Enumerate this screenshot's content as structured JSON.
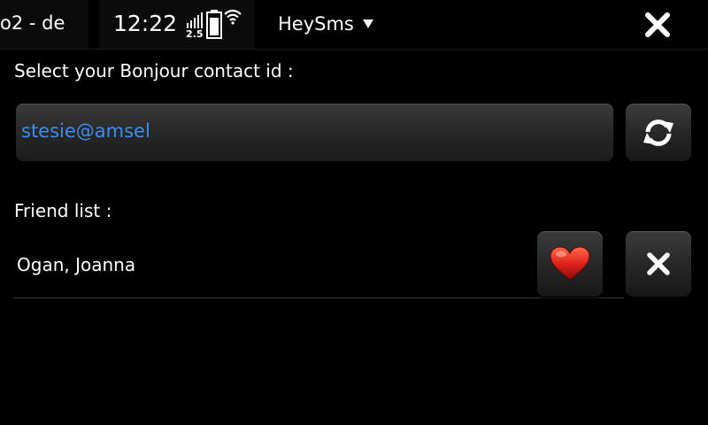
{
  "status_bar": {
    "operator": "o2 - de",
    "time": "12:22",
    "network_type": "2.5",
    "app_title": "HeySms",
    "icons": [
      "signal-icon",
      "battery-icon",
      "wifi-icon",
      "menu-dropdown-icon",
      "close-icon"
    ]
  },
  "main": {
    "contact_prompt": "Select your Bonjour contact id :",
    "contact_id_value": "stesie@amsel",
    "friend_list_label": "Friend list :",
    "friends": [
      {
        "name": "Ogan, Joanna",
        "favorite": true
      }
    ]
  },
  "colors": {
    "background": "#000000",
    "input_text": "#3b8ef0",
    "heart": "#e0231c"
  }
}
